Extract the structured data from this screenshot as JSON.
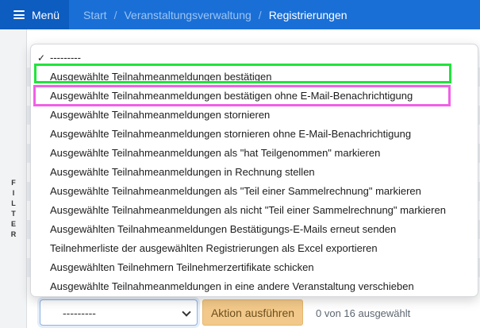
{
  "navbar": {
    "menu_label": "Menü",
    "breadcrumbs": [
      "Start",
      "Veranstaltungsverwaltung",
      "Registrierungen"
    ],
    "separator": "/"
  },
  "filter_rail": {
    "label_letters": [
      "F",
      "I",
      "L",
      "T",
      "E",
      "R"
    ]
  },
  "actions_dropdown": {
    "check_mark": "✓",
    "options": [
      "---------",
      "Ausgewählte Teilnahmeanmeldungen bestätigen",
      "Ausgewählte Teilnahmeanmeldungen bestätigen ohne E-Mail-Benachrichtigung",
      "Ausgewählte Teilnahmeanmeldungen stornieren",
      "Ausgewählte Teilnahmeanmeldungen stornieren ohne E-Mail-Benachrichtigung",
      "Ausgewählte Teilnahmeanmeldungen als \"hat Teilgenommen\" markieren",
      "Ausgewählte Teilnahmeanmeldungen in Rechnung stellen",
      "Ausgewählte Teilnahmeanmeldungen als \"Teil einer Sammelrechnung\" markieren",
      "Ausgewählte Teilnahmeanmeldungen als nicht \"Teil einer Sammelrechnung\" markieren",
      "Ausgewählten Teilnahmeanmeldungen Bestätigungs-E-Mails erneut senden",
      "Teilnehmerliste der ausgewählten Registrierungen als Excel exportieren",
      "Ausgewählten Teilnehmern Teilnehmerzertifikate schicken",
      "Ausgewählte Teilnahmeanmeldungen in eine andere Veranstaltung verschieben"
    ]
  },
  "action_bar": {
    "select_value": "---------",
    "run_button_label": "Aktion ausführen",
    "selection_count": "0 von 16 ausgewählt"
  },
  "colors": {
    "navbar": "#1a6fd6",
    "highlight_green": "#22e33c",
    "highlight_magenta": "#f060e6",
    "run_button": "#f2c98a"
  }
}
